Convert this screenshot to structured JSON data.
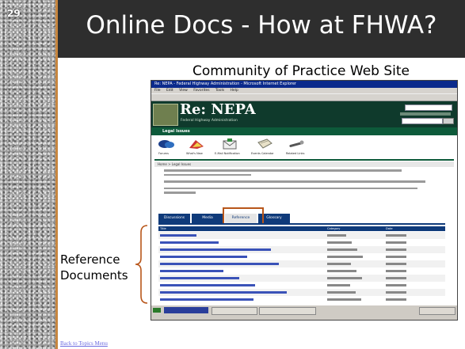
{
  "slide": {
    "number": "29",
    "title": "Online Docs - How at FHWA?",
    "subtitle": "Community of Practice Web Site",
    "left_label_line1": "Reference",
    "left_label_line2": "Documents",
    "back_link": "Back to Topics Menu"
  },
  "browser": {
    "window_title": "Re: NEPA - Federal Highway Administration - Microsoft Internet Explorer",
    "menu": [
      "File",
      "Edit",
      "View",
      "Favorites",
      "Tools",
      "Help"
    ],
    "site_name": "Re: NEPA",
    "site_sub": "Federal Highway Administration",
    "section": "Legal Issues",
    "icons": [
      {
        "name": "Forums",
        "icon": "forum-icon"
      },
      {
        "name": "What's New",
        "icon": "news-icon"
      },
      {
        "name": "E-Mail Notification",
        "icon": "mail-icon"
      },
      {
        "name": "Events Calendar",
        "icon": "calendar-icon"
      },
      {
        "name": "Related Links",
        "icon": "links-icon"
      }
    ],
    "breadcrumb": "Home > Legal Issues",
    "tabs": [
      "Discussions",
      "Media",
      "Reference",
      "Glossary"
    ],
    "active_tab": "Reference",
    "table": {
      "headers": [
        "Title",
        "Category",
        "Date"
      ],
      "rows": [
        [
          "",
          "",
          " "
        ],
        [
          "",
          "",
          ""
        ],
        [
          "",
          "",
          ""
        ],
        [
          "",
          "",
          ""
        ],
        [
          "",
          "",
          ""
        ],
        [
          "",
          "",
          ""
        ],
        [
          "",
          "",
          ""
        ],
        [
          "",
          "",
          ""
        ],
        [
          "",
          "",
          ""
        ],
        [
          "",
          "",
          ""
        ]
      ]
    }
  },
  "colors": {
    "title_bar": "#2e2e2e",
    "accent": "#c7863f",
    "highlight": "#b8561a",
    "site_green": "#0f3a2c",
    "tab_blue": "#0f3a7a"
  }
}
